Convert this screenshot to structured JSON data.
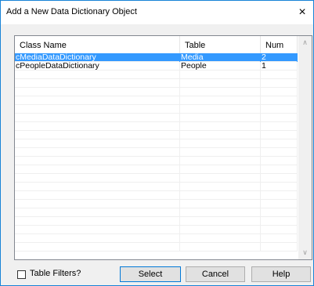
{
  "window": {
    "title": "Add a New Data Dictionary Object",
    "close_symbol": "×"
  },
  "columns": [
    "Class Name",
    "Table",
    "Num"
  ],
  "rows": [
    {
      "class_name": "cMediaDataDictionary",
      "table": "Media",
      "num": "2",
      "selected": true
    },
    {
      "class_name": "cPeopleDataDictionary",
      "table": "People",
      "num": "1",
      "selected": false
    }
  ],
  "footer": {
    "table_filters_label": "Table Filters?",
    "table_filters_checked": false,
    "select_label": "Select",
    "cancel_label": "Cancel",
    "help_label": "Help"
  },
  "icons": {
    "scroll_up": "chevron-up-icon",
    "scroll_down": "chevron-down-icon"
  },
  "colors": {
    "selection": "#3399ff",
    "window_border": "#1883d7"
  }
}
